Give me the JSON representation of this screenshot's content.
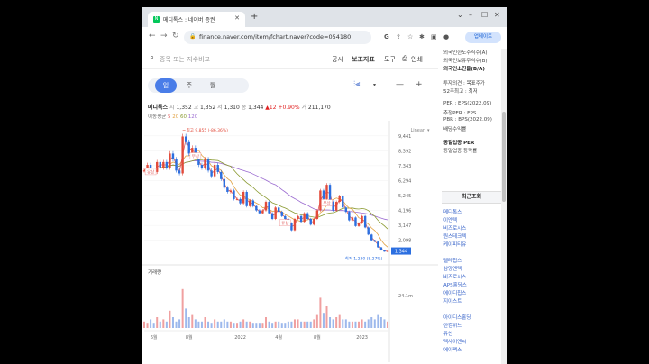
{
  "browser": {
    "tab_title": "메디톡스 : 네이버 증권",
    "new_tab": "+",
    "url": "finance.naver.com/item/fchart.naver?code=054180",
    "update_label": "업데이트"
  },
  "page": {
    "search_placeholder": "종목 또는 지수비교",
    "links": [
      "공시",
      "보조지표",
      "도구",
      "인쇄"
    ],
    "periods": [
      "일",
      "주",
      "월"
    ],
    "active_period": "일"
  },
  "quote": {
    "name": "메디톡스",
    "open_label": "시",
    "open": "1,352",
    "high_label": "고",
    "high": "1,352",
    "low_label": "저",
    "low": "1,310",
    "close_label": "종",
    "close": "1,344",
    "change": "▲12",
    "change_pct": "+0.90%",
    "volume_label": "거",
    "volume": "211,170",
    "ma_label": "이동평균",
    "ma": [
      "5",
      "20",
      "60",
      "120"
    ]
  },
  "chart_data": {
    "type": "line",
    "scale": "Linear",
    "yticks": [
      "9,441",
      "8,392",
      "7,343",
      "6,294",
      "5,245",
      "4,196",
      "3,147",
      "2,098"
    ],
    "xticks": [
      "6월",
      "8월",
      "2022",
      "4월",
      "8월",
      "2023"
    ],
    "high_marker": "최고 9,855 (-86.36%)",
    "low_marker": "최저 1,230 (8.27%)",
    "current_price": "1,344",
    "volume_title": "거래량",
    "volume_tick": "24.1m",
    "annotations": [
      "유상",
      "무상",
      "유상",
      "무상"
    ],
    "ma_colors": {
      "ma5": "#e05a5a",
      "ma20": "#e0a040",
      "ma60": "#8a9a30",
      "ma120": "#9a6ad0"
    },
    "price": [
      7000,
      7400,
      7000,
      6900,
      7600,
      7200,
      7600,
      7200,
      8200,
      7800,
      7000,
      6800,
      9400,
      9000,
      8200,
      8600,
      8000,
      7400,
      7200,
      7800,
      7000,
      6600,
      7400,
      6900,
      6400,
      5800,
      5500,
      5600,
      5000,
      5000,
      4700,
      5500,
      4500,
      4900,
      4500,
      4200,
      4000,
      4200,
      4800,
      4000,
      3600,
      4400,
      4100,
      3800,
      3600,
      3300,
      2800,
      3600,
      3800,
      3400,
      4000,
      3600,
      3200,
      3600,
      4200,
      5600,
      5000,
      6000,
      4800,
      4200,
      4800,
      5200,
      4400,
      4100,
      3500,
      3700,
      3100,
      3300,
      3800,
      3000,
      2500,
      2100,
      2000,
      1600,
      1400,
      1300,
      1344
    ],
    "volume": [
      3,
      2,
      4,
      2,
      5,
      3,
      4,
      3,
      8,
      5,
      3,
      4,
      18,
      9,
      5,
      6,
      4,
      3,
      3,
      5,
      3,
      2,
      4,
      3,
      3,
      4,
      3,
      3,
      2,
      2,
      3,
      4,
      3,
      3,
      2,
      2,
      2,
      2,
      5,
      3,
      2,
      3,
      3,
      2,
      2,
      3,
      3,
      4,
      4,
      3,
      3,
      3,
      3,
      4,
      6,
      14,
      7,
      10,
      5,
      4,
      5,
      6,
      4,
      4,
      3,
      3,
      3,
      3,
      4,
      3,
      4,
      5,
      4,
      6,
      5,
      4,
      3
    ]
  },
  "sidebar": {
    "top_items": [
      "외국인한도주식수(A)",
      "외국인보유주식수(B)",
      "외국인소진율(B/A)"
    ],
    "mid_items": [
      "투자의견 : 목표주가",
      "52주최고 : 최저"
    ],
    "per_items": [
      "PER : EPS(2022.09)",
      "추정PER : EPS",
      "PBR : BPS(2022.09)",
      "배당수익률"
    ],
    "industry_items": [
      "동일업종 PER",
      "동일업종 등락률"
    ],
    "recent_title": "최근조회",
    "recent_group1": [
      "메디톡스",
      "이엔텍",
      "비즈로시스",
      "원스테크텍",
      "케이피티유"
    ],
    "recent_group2": [
      "텔레칩스",
      "삼양엔텍",
      "비즈로시스",
      "APS홀딩스",
      "에이디칩스",
      "지이스트"
    ],
    "recent_group3": [
      "아이디스홀딩",
      "한컴위드",
      "유신",
      "텍사이엔씨",
      "에이팩스"
    ]
  }
}
